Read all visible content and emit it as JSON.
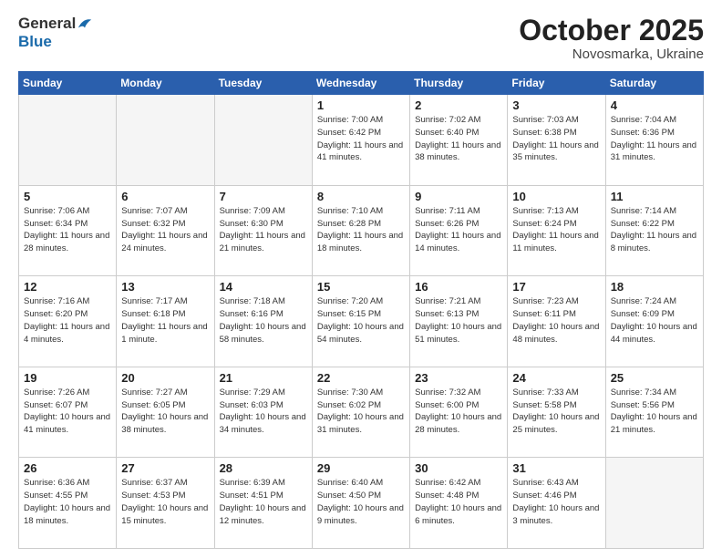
{
  "header": {
    "logo_line1": "General",
    "logo_line2": "Blue",
    "month": "October 2025",
    "location": "Novosmarka, Ukraine"
  },
  "weekdays": [
    "Sunday",
    "Monday",
    "Tuesday",
    "Wednesday",
    "Thursday",
    "Friday",
    "Saturday"
  ],
  "weeks": [
    [
      {
        "day": "",
        "sunrise": "",
        "sunset": "",
        "daylight": ""
      },
      {
        "day": "",
        "sunrise": "",
        "sunset": "",
        "daylight": ""
      },
      {
        "day": "",
        "sunrise": "",
        "sunset": "",
        "daylight": ""
      },
      {
        "day": "1",
        "sunrise": "Sunrise: 7:00 AM",
        "sunset": "Sunset: 6:42 PM",
        "daylight": "Daylight: 11 hours and 41 minutes."
      },
      {
        "day": "2",
        "sunrise": "Sunrise: 7:02 AM",
        "sunset": "Sunset: 6:40 PM",
        "daylight": "Daylight: 11 hours and 38 minutes."
      },
      {
        "day": "3",
        "sunrise": "Sunrise: 7:03 AM",
        "sunset": "Sunset: 6:38 PM",
        "daylight": "Daylight: 11 hours and 35 minutes."
      },
      {
        "day": "4",
        "sunrise": "Sunrise: 7:04 AM",
        "sunset": "Sunset: 6:36 PM",
        "daylight": "Daylight: 11 hours and 31 minutes."
      }
    ],
    [
      {
        "day": "5",
        "sunrise": "Sunrise: 7:06 AM",
        "sunset": "Sunset: 6:34 PM",
        "daylight": "Daylight: 11 hours and 28 minutes."
      },
      {
        "day": "6",
        "sunrise": "Sunrise: 7:07 AM",
        "sunset": "Sunset: 6:32 PM",
        "daylight": "Daylight: 11 hours and 24 minutes."
      },
      {
        "day": "7",
        "sunrise": "Sunrise: 7:09 AM",
        "sunset": "Sunset: 6:30 PM",
        "daylight": "Daylight: 11 hours and 21 minutes."
      },
      {
        "day": "8",
        "sunrise": "Sunrise: 7:10 AM",
        "sunset": "Sunset: 6:28 PM",
        "daylight": "Daylight: 11 hours and 18 minutes."
      },
      {
        "day": "9",
        "sunrise": "Sunrise: 7:11 AM",
        "sunset": "Sunset: 6:26 PM",
        "daylight": "Daylight: 11 hours and 14 minutes."
      },
      {
        "day": "10",
        "sunrise": "Sunrise: 7:13 AM",
        "sunset": "Sunset: 6:24 PM",
        "daylight": "Daylight: 11 hours and 11 minutes."
      },
      {
        "day": "11",
        "sunrise": "Sunrise: 7:14 AM",
        "sunset": "Sunset: 6:22 PM",
        "daylight": "Daylight: 11 hours and 8 minutes."
      }
    ],
    [
      {
        "day": "12",
        "sunrise": "Sunrise: 7:16 AM",
        "sunset": "Sunset: 6:20 PM",
        "daylight": "Daylight: 11 hours and 4 minutes."
      },
      {
        "day": "13",
        "sunrise": "Sunrise: 7:17 AM",
        "sunset": "Sunset: 6:18 PM",
        "daylight": "Daylight: 11 hours and 1 minute."
      },
      {
        "day": "14",
        "sunrise": "Sunrise: 7:18 AM",
        "sunset": "Sunset: 6:16 PM",
        "daylight": "Daylight: 10 hours and 58 minutes."
      },
      {
        "day": "15",
        "sunrise": "Sunrise: 7:20 AM",
        "sunset": "Sunset: 6:15 PM",
        "daylight": "Daylight: 10 hours and 54 minutes."
      },
      {
        "day": "16",
        "sunrise": "Sunrise: 7:21 AM",
        "sunset": "Sunset: 6:13 PM",
        "daylight": "Daylight: 10 hours and 51 minutes."
      },
      {
        "day": "17",
        "sunrise": "Sunrise: 7:23 AM",
        "sunset": "Sunset: 6:11 PM",
        "daylight": "Daylight: 10 hours and 48 minutes."
      },
      {
        "day": "18",
        "sunrise": "Sunrise: 7:24 AM",
        "sunset": "Sunset: 6:09 PM",
        "daylight": "Daylight: 10 hours and 44 minutes."
      }
    ],
    [
      {
        "day": "19",
        "sunrise": "Sunrise: 7:26 AM",
        "sunset": "Sunset: 6:07 PM",
        "daylight": "Daylight: 10 hours and 41 minutes."
      },
      {
        "day": "20",
        "sunrise": "Sunrise: 7:27 AM",
        "sunset": "Sunset: 6:05 PM",
        "daylight": "Daylight: 10 hours and 38 minutes."
      },
      {
        "day": "21",
        "sunrise": "Sunrise: 7:29 AM",
        "sunset": "Sunset: 6:03 PM",
        "daylight": "Daylight: 10 hours and 34 minutes."
      },
      {
        "day": "22",
        "sunrise": "Sunrise: 7:30 AM",
        "sunset": "Sunset: 6:02 PM",
        "daylight": "Daylight: 10 hours and 31 minutes."
      },
      {
        "day": "23",
        "sunrise": "Sunrise: 7:32 AM",
        "sunset": "Sunset: 6:00 PM",
        "daylight": "Daylight: 10 hours and 28 minutes."
      },
      {
        "day": "24",
        "sunrise": "Sunrise: 7:33 AM",
        "sunset": "Sunset: 5:58 PM",
        "daylight": "Daylight: 10 hours and 25 minutes."
      },
      {
        "day": "25",
        "sunrise": "Sunrise: 7:34 AM",
        "sunset": "Sunset: 5:56 PM",
        "daylight": "Daylight: 10 hours and 21 minutes."
      }
    ],
    [
      {
        "day": "26",
        "sunrise": "Sunrise: 6:36 AM",
        "sunset": "Sunset: 4:55 PM",
        "daylight": "Daylight: 10 hours and 18 minutes."
      },
      {
        "day": "27",
        "sunrise": "Sunrise: 6:37 AM",
        "sunset": "Sunset: 4:53 PM",
        "daylight": "Daylight: 10 hours and 15 minutes."
      },
      {
        "day": "28",
        "sunrise": "Sunrise: 6:39 AM",
        "sunset": "Sunset: 4:51 PM",
        "daylight": "Daylight: 10 hours and 12 minutes."
      },
      {
        "day": "29",
        "sunrise": "Sunrise: 6:40 AM",
        "sunset": "Sunset: 4:50 PM",
        "daylight": "Daylight: 10 hours and 9 minutes."
      },
      {
        "day": "30",
        "sunrise": "Sunrise: 6:42 AM",
        "sunset": "Sunset: 4:48 PM",
        "daylight": "Daylight: 10 hours and 6 minutes."
      },
      {
        "day": "31",
        "sunrise": "Sunrise: 6:43 AM",
        "sunset": "Sunset: 4:46 PM",
        "daylight": "Daylight: 10 hours and 3 minutes."
      },
      {
        "day": "",
        "sunrise": "",
        "sunset": "",
        "daylight": ""
      }
    ]
  ]
}
